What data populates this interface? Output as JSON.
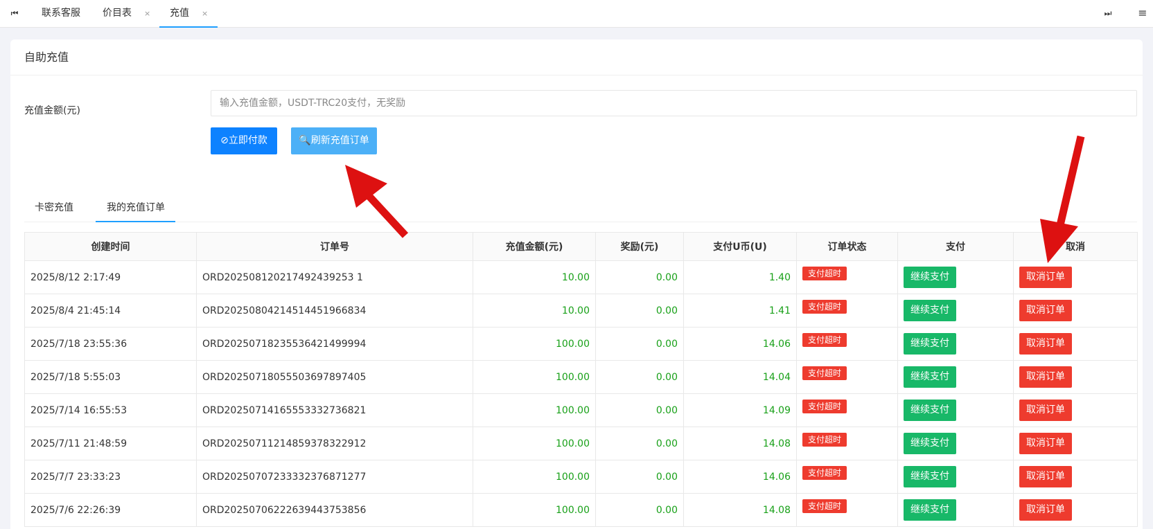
{
  "topbar": {
    "first_icon": "⏮",
    "last_icon": "⏭",
    "menu_icon": "≡",
    "tabs": [
      {
        "label": "联系客服",
        "close": ""
      },
      {
        "label": "价目表",
        "close": "×"
      },
      {
        "label": "充值",
        "close": "×"
      }
    ]
  },
  "card": {
    "title": "自助充值",
    "amount_label": "充值金额(元)",
    "amount_placeholder": "输入充值金额，USDT-TRC20支付，无奖励",
    "pay_button": "⊘立即付款",
    "refresh_button": "🔍刷新充值订单"
  },
  "subtabs": [
    {
      "label": "卡密充值"
    },
    {
      "label": "我的充值订单"
    }
  ],
  "table": {
    "headers": [
      "创建时间",
      "订单号",
      "充值金额(元)",
      "奖励(元)",
      "支付U币(U)",
      "订单状态",
      "支付",
      "取消"
    ],
    "status_label": "支付超时",
    "pay_label": "继续支付",
    "cancel_label": "取消订单",
    "rows": [
      {
        "time": "2025/8/12 2:17:49",
        "order": "ORD202508120217492439253 1",
        "amount": "10.00",
        "reward": "0.00",
        "usdt": "1.40"
      },
      {
        "time": "2025/8/4 21:45:14",
        "order": "ORD20250804214514451966834",
        "amount": "10.00",
        "reward": "0.00",
        "usdt": "1.41"
      },
      {
        "time": "2025/7/18 23:55:36",
        "order": "ORD20250718235536421499994",
        "amount": "100.00",
        "reward": "0.00",
        "usdt": "14.06"
      },
      {
        "time": "2025/7/18 5:55:03",
        "order": "ORD20250718055503697897405",
        "amount": "100.00",
        "reward": "0.00",
        "usdt": "14.04"
      },
      {
        "time": "2025/7/14 16:55:53",
        "order": "ORD20250714165553332736821",
        "amount": "100.00",
        "reward": "0.00",
        "usdt": "14.09"
      },
      {
        "time": "2025/7/11 21:48:59",
        "order": "ORD20250711214859378322912",
        "amount": "100.00",
        "reward": "0.00",
        "usdt": "14.08"
      },
      {
        "time": "2025/7/7 23:33:23",
        "order": "ORD20250707233332376871277",
        "amount": "100.00",
        "reward": "0.00",
        "usdt": "14.06"
      },
      {
        "time": "2025/7/6 22:26:39",
        "order": "ORD20250706222639443753856",
        "amount": "100.00",
        "reward": "0.00",
        "usdt": "14.08"
      }
    ]
  },
  "colors": {
    "accent": "#1e9fff",
    "pay_button": "#0d82ff",
    "refresh_button": "#4cb0f7",
    "green": "#18b868",
    "red": "#ee3b2e",
    "arrow": "#dd1111"
  }
}
